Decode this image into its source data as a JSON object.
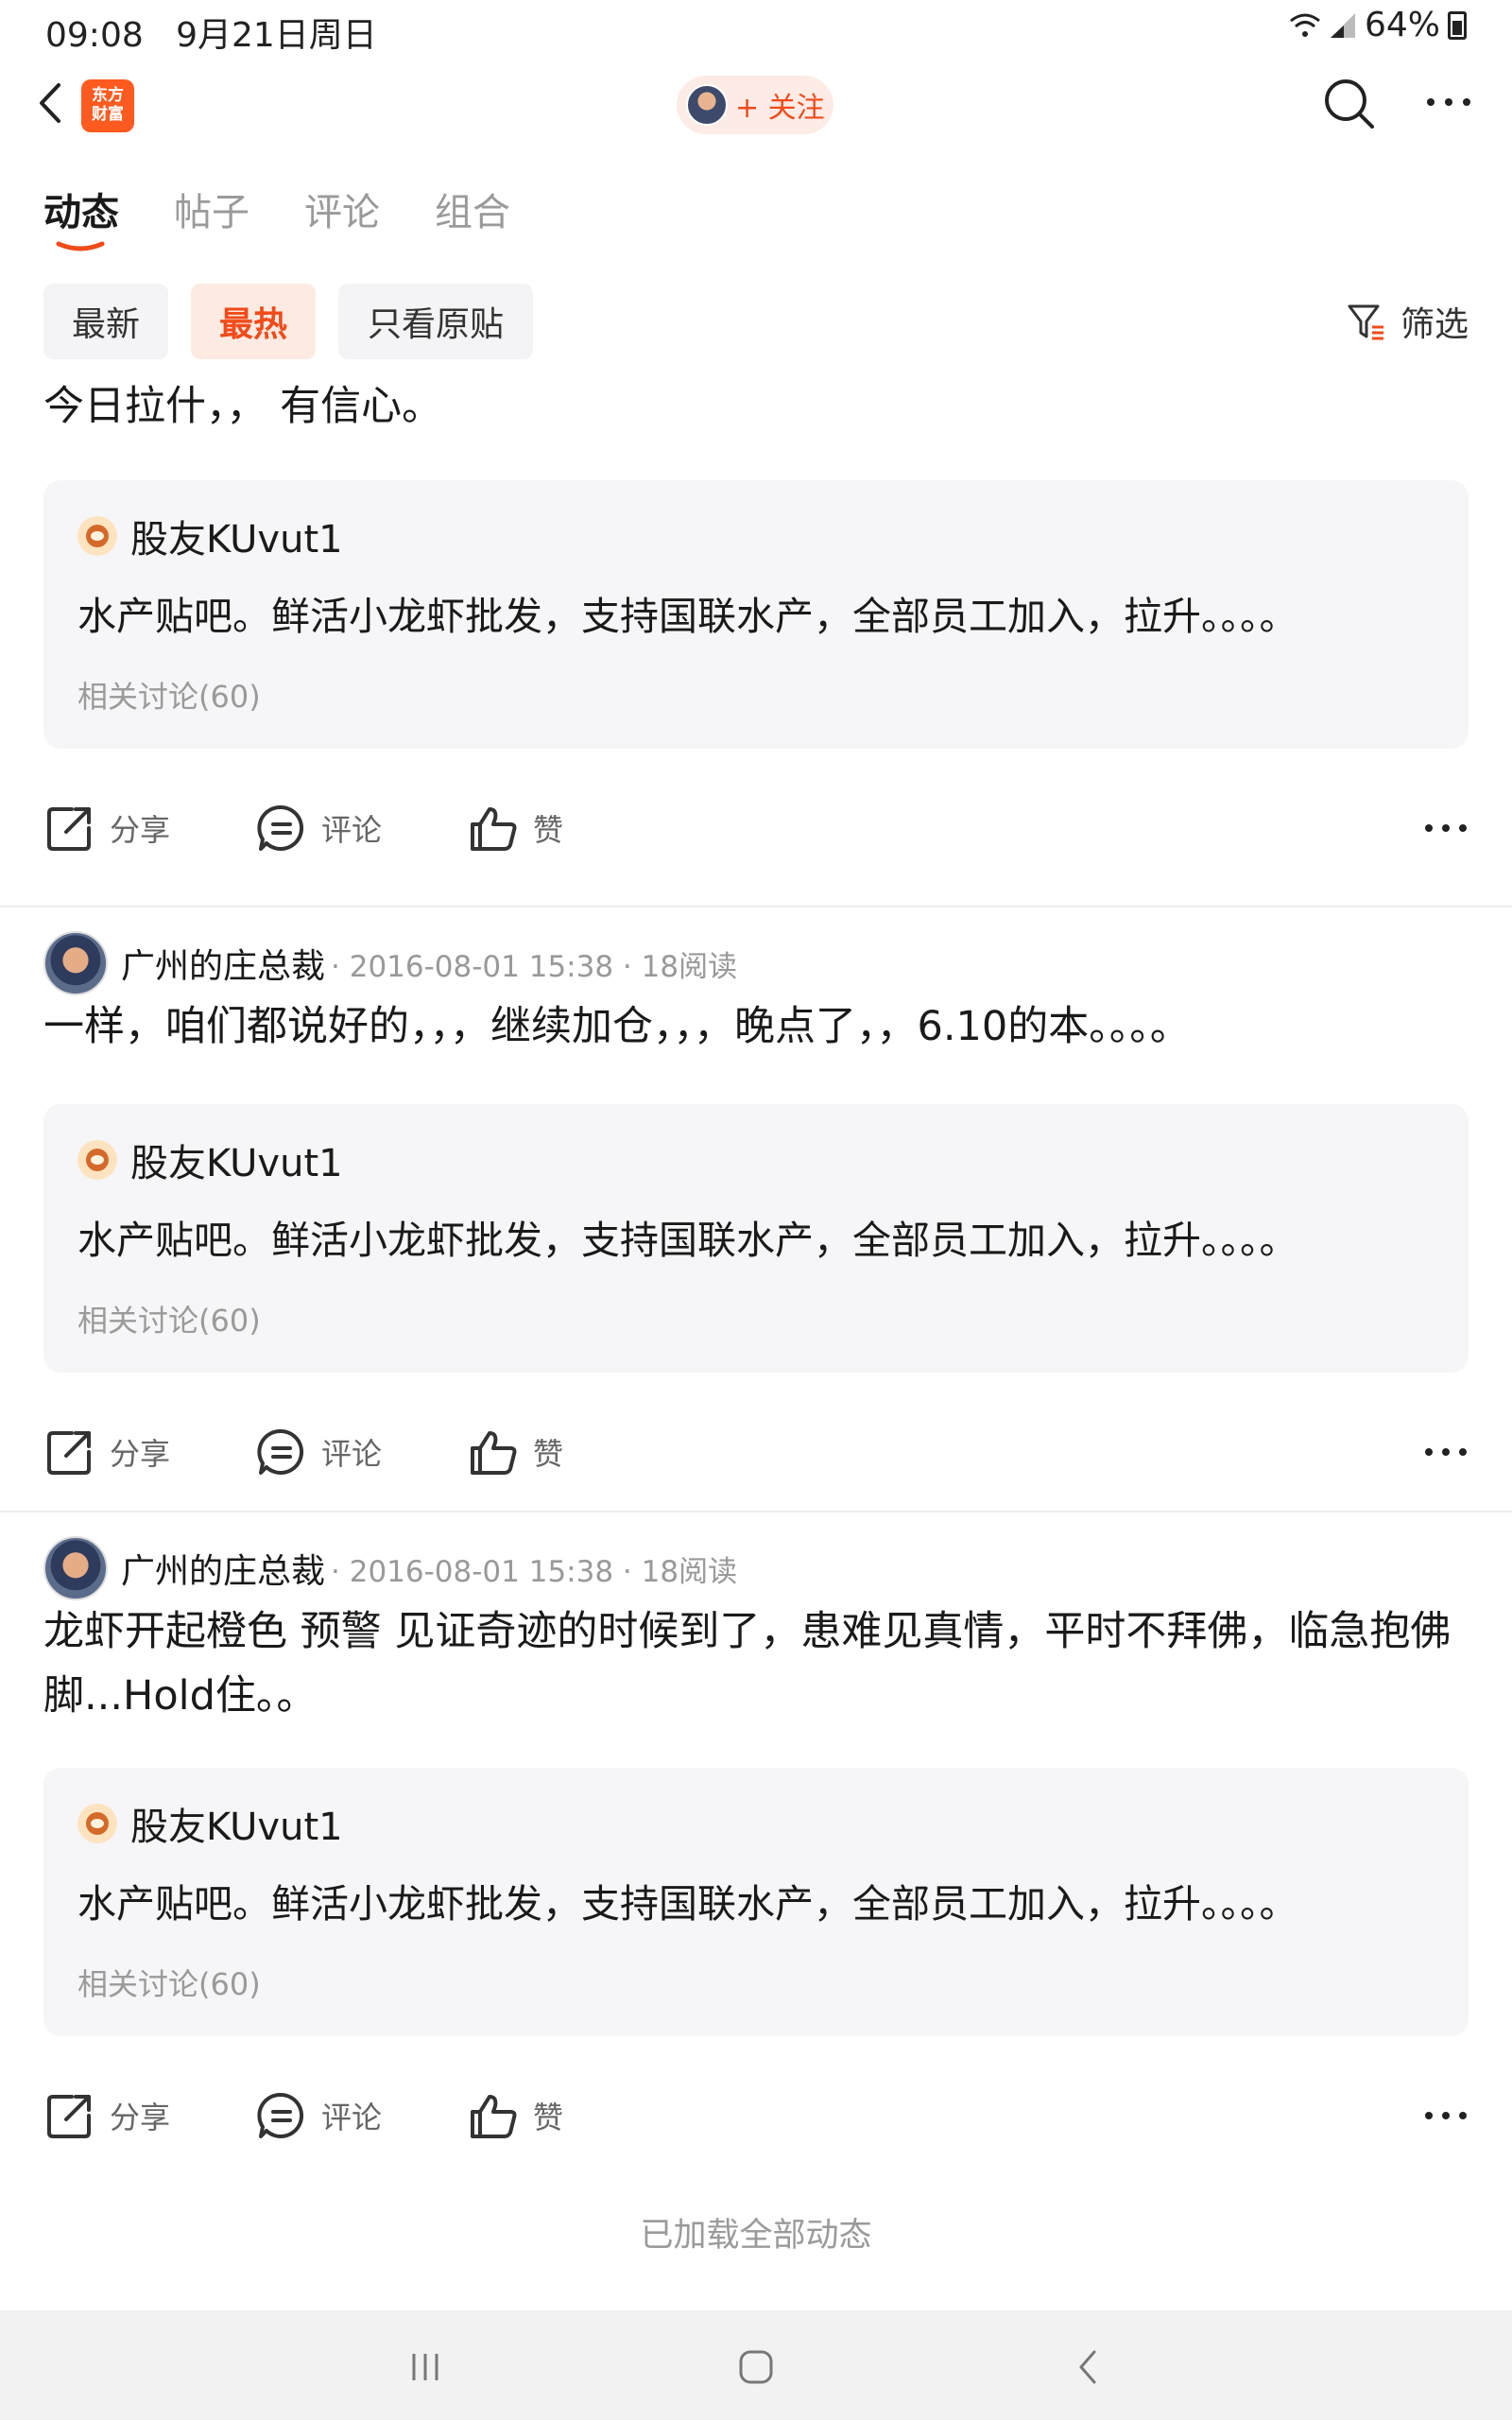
{
  "status_bar": {
    "time": "09:08",
    "date": "9月21日周日",
    "battery": "64%"
  },
  "header": {
    "logo_text": "东方财富",
    "follow_label": "+ 关注"
  },
  "tabs": [
    {
      "label": "动态",
      "active": true
    },
    {
      "label": "帖子",
      "active": false
    },
    {
      "label": "评论",
      "active": false
    },
    {
      "label": "组合",
      "active": false
    }
  ],
  "filters": {
    "chips": [
      {
        "label": "最新",
        "active": false
      },
      {
        "label": "最热",
        "active": true
      },
      {
        "label": "只看原贴",
        "active": false
      }
    ],
    "filter_label": "筛选"
  },
  "posts": [
    {
      "author": "",
      "meta": "",
      "body": "今日拉什，， 有信心。",
      "quote": {
        "user": "股友KUvut1",
        "text": "水产贴吧。鲜活小龙虾批发，支持国联水产，全部员工加入，拉升。。。。",
        "related": "相关讨论(60)"
      }
    },
    {
      "author": "广州的庄总裁",
      "meta": "· 2016-08-01 15:38 · 18阅读",
      "body": "一样，咱们都说好的，，，继续加仓，，，晚点了，，6.10的本。。。。",
      "quote": {
        "user": "股友KUvut1",
        "text": "水产贴吧。鲜活小龙虾批发，支持国联水产，全部员工加入，拉升。。。。",
        "related": "相关讨论(60)"
      }
    },
    {
      "author": "广州的庄总裁",
      "meta": "· 2016-08-01 15:38 · 18阅读",
      "body": "龙虾开起橙色 预警 见证奇迹的时候到了，患难见真情，平时不拜佛，临急抱佛脚...Hold住。。",
      "quote": {
        "user": "股友KUvut1",
        "text": "水产贴吧。鲜活小龙虾批发，支持国联水产，全部员工加入，拉升。。。。",
        "related": "相关讨论(60)"
      }
    }
  ],
  "actions": {
    "share": "分享",
    "comment": "评论",
    "like": "赞"
  },
  "footer": {
    "loaded_all": "已加载全部动态"
  },
  "colors": {
    "accent": "#f04b1a",
    "brand": "#ff5a1f",
    "quote_bg": "#f6f6f8"
  }
}
